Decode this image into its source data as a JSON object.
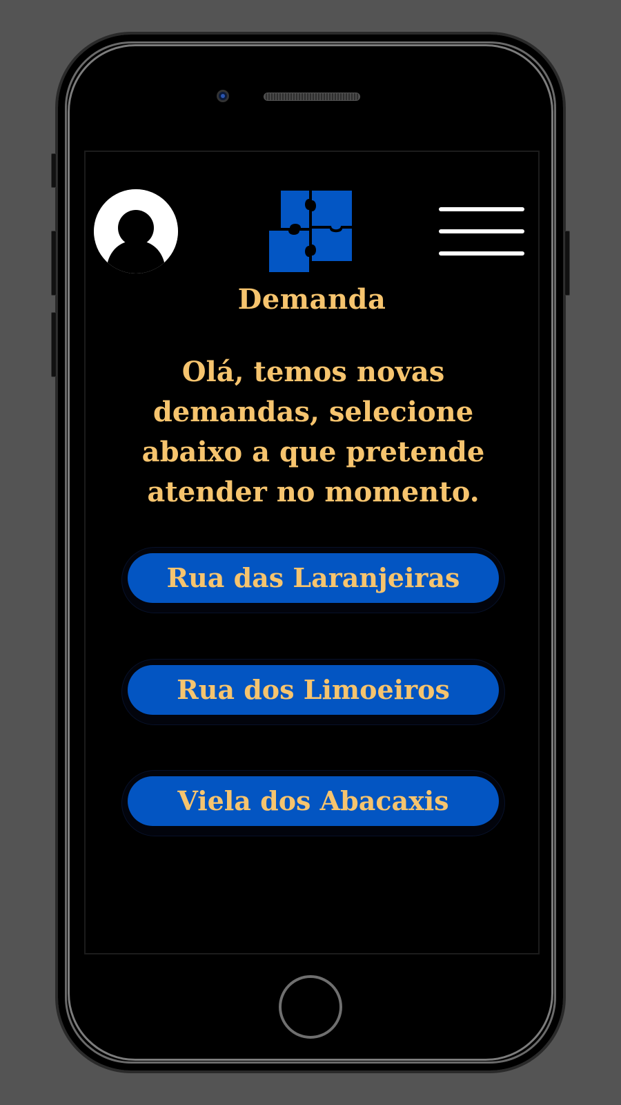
{
  "app": {
    "title": "Demanda"
  },
  "header": {
    "avatar_icon": "user-avatar-icon",
    "logo_icon": "puzzle-logo-icon",
    "menu_icon": "hamburger-menu-icon"
  },
  "main": {
    "greeting": "Olá, temos novas demandas, selecione abaixo a que pretende atender no momento.",
    "demands": [
      {
        "label": "Rua das Laranjeiras"
      },
      {
        "label": "Rua dos Limoeiros"
      },
      {
        "label": "Viela dos Abacaxis"
      }
    ]
  },
  "colors": {
    "background": "#545454",
    "screen": "#000000",
    "accent_text": "#f6c46e",
    "button": "#0355c2",
    "logo": "#0356c4"
  }
}
